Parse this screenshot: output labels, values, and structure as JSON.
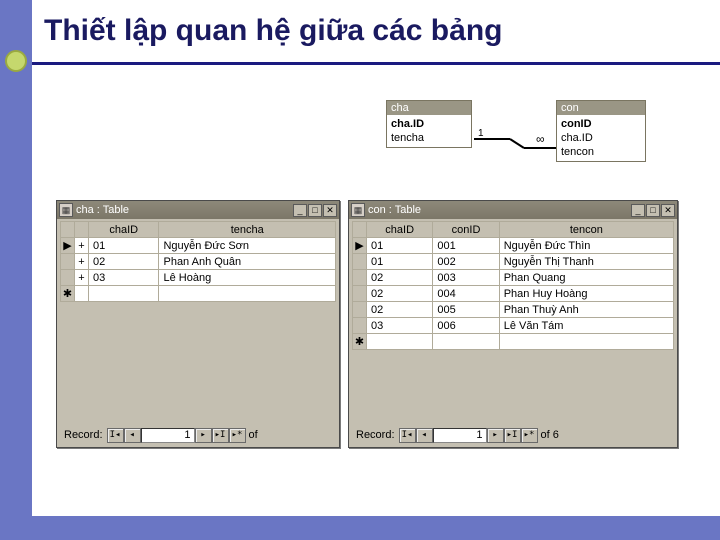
{
  "title": "Thiết lập quan hệ giữa các bảng",
  "relationship": {
    "left": {
      "name": "cha",
      "fields": [
        "cha.ID",
        "tencha"
      ]
    },
    "right": {
      "name": "con",
      "fields": [
        "conID",
        "cha.ID",
        "tencon"
      ]
    },
    "card_left": "1",
    "card_right": "∞"
  },
  "chaWindow": {
    "title": "cha : Table",
    "columns": [
      "chaID",
      "tencha"
    ],
    "rows": [
      {
        "sel": "▶",
        "exp": "+",
        "chaID": "01",
        "tencha": "Nguyễn Đức Sơn"
      },
      {
        "sel": "",
        "exp": "+",
        "chaID": "02",
        "tencha": "Phan Anh Quân"
      },
      {
        "sel": "",
        "exp": "+",
        "chaID": "03",
        "tencha": "Lê Hoàng"
      }
    ],
    "newrow": "✱",
    "record": {
      "label": "Record:",
      "value": "1",
      "of": "of"
    }
  },
  "conWindow": {
    "title": "con : Table",
    "columns": [
      "chaID",
      "conID",
      "tencon"
    ],
    "rows": [
      {
        "sel": "▶",
        "chaID": "01",
        "conID": "001",
        "tencon": "Nguyễn Đức Thìn"
      },
      {
        "sel": "",
        "chaID": "01",
        "conID": "002",
        "tencon": "Nguyễn Thị Thanh"
      },
      {
        "sel": "",
        "chaID": "02",
        "conID": "003",
        "tencon": "Phan Quang"
      },
      {
        "sel": "",
        "chaID": "02",
        "conID": "004",
        "tencon": "Phan Huy Hoàng"
      },
      {
        "sel": "",
        "chaID": "02",
        "conID": "005",
        "tencon": "Phan Thuỳ Anh"
      },
      {
        "sel": "",
        "chaID": "03",
        "conID": "006",
        "tencon": "Lê Văn Tám"
      }
    ],
    "newrow": "✱",
    "record": {
      "label": "Record:",
      "value": "1",
      "of": "of  6"
    }
  },
  "icons": {
    "first": "I◂",
    "prev": "◂",
    "next": "▸",
    "last": "▸I",
    "new": "▸*",
    "min": "_",
    "max": "□",
    "close": "✕",
    "table": "▦"
  }
}
